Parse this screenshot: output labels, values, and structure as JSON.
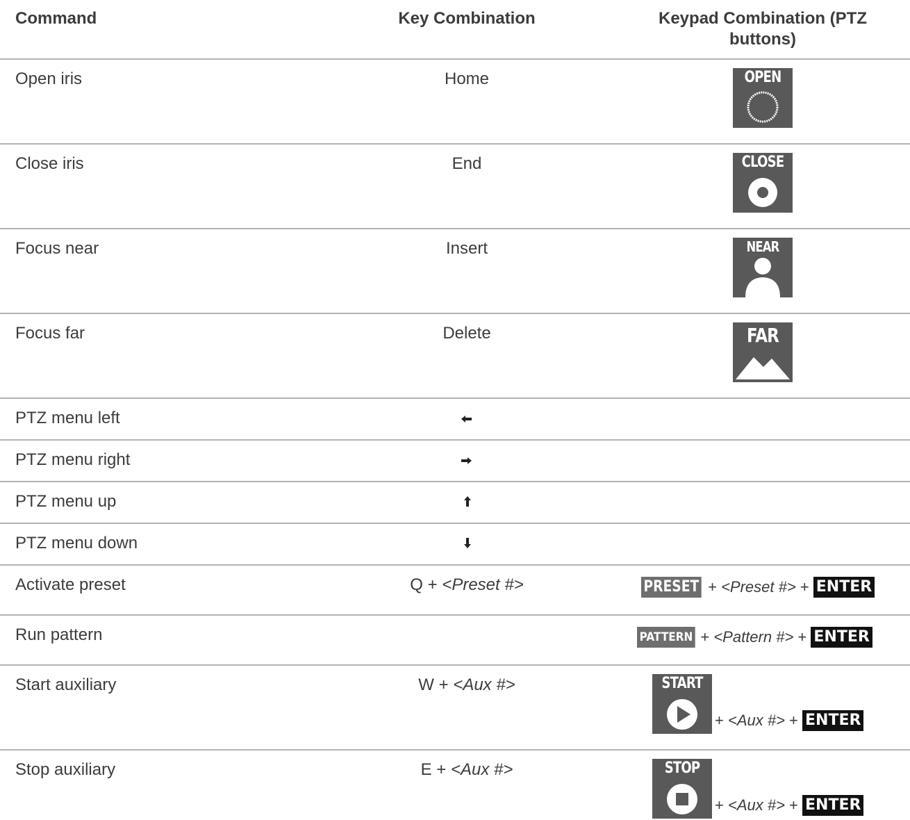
{
  "headers": {
    "command": "Command",
    "key_combination": "Key Combination",
    "keypad_combination": "Keypad Combination (PTZ buttons)"
  },
  "rows": [
    {
      "command": "Open iris",
      "key": "Home",
      "keypad_icon": "OPEN"
    },
    {
      "command": "Close iris",
      "key": "End",
      "keypad_icon": "CLOSE"
    },
    {
      "command": "Focus near",
      "key": "Insert",
      "keypad_icon": "NEAR"
    },
    {
      "command": "Focus far",
      "key": "Delete",
      "keypad_icon": "FAR"
    },
    {
      "command": "PTZ menu left",
      "key_icon": "arrow-left-icon",
      "key_glyph": "🡐"
    },
    {
      "command": "PTZ menu right",
      "key_icon": "arrow-right-icon",
      "key_glyph": "🡒"
    },
    {
      "command": "PTZ menu up",
      "key_icon": "arrow-up-icon",
      "key_glyph": "🡑"
    },
    {
      "command": "PTZ menu down",
      "key_icon": "arrow-down-icon",
      "key_glyph": "🡓"
    },
    {
      "command": "Activate preset",
      "key_prefix": "Q + ",
      "key_var": "<Preset #>",
      "keypad_button": "PRESET",
      "keypad_plus1": " + ",
      "keypad_var": "<Preset #>",
      "keypad_plus2": " + ",
      "keypad_enter": "ENTER"
    },
    {
      "command": "Run pattern",
      "keypad_button": "PATTERN",
      "keypad_plus1": " + ",
      "keypad_var": "<Pattern #>",
      "keypad_plus2": " + ",
      "keypad_enter": "ENTER"
    },
    {
      "command": "Start auxiliary",
      "key_prefix": "W + ",
      "key_var": "<Aux #>",
      "keypad_icon": "START",
      "keypad_plus1": " + ",
      "keypad_var": "<Aux #>",
      "keypad_plus2": " + ",
      "keypad_enter": "ENTER"
    },
    {
      "command": "Stop auxiliary",
      "key_prefix": "E + ",
      "key_var": "<Aux #>",
      "keypad_icon": "STOP",
      "keypad_plus1": " + ",
      "keypad_var": "<Aux #>",
      "keypad_plus2": " + ",
      "keypad_enter": "ENTER"
    }
  ]
}
